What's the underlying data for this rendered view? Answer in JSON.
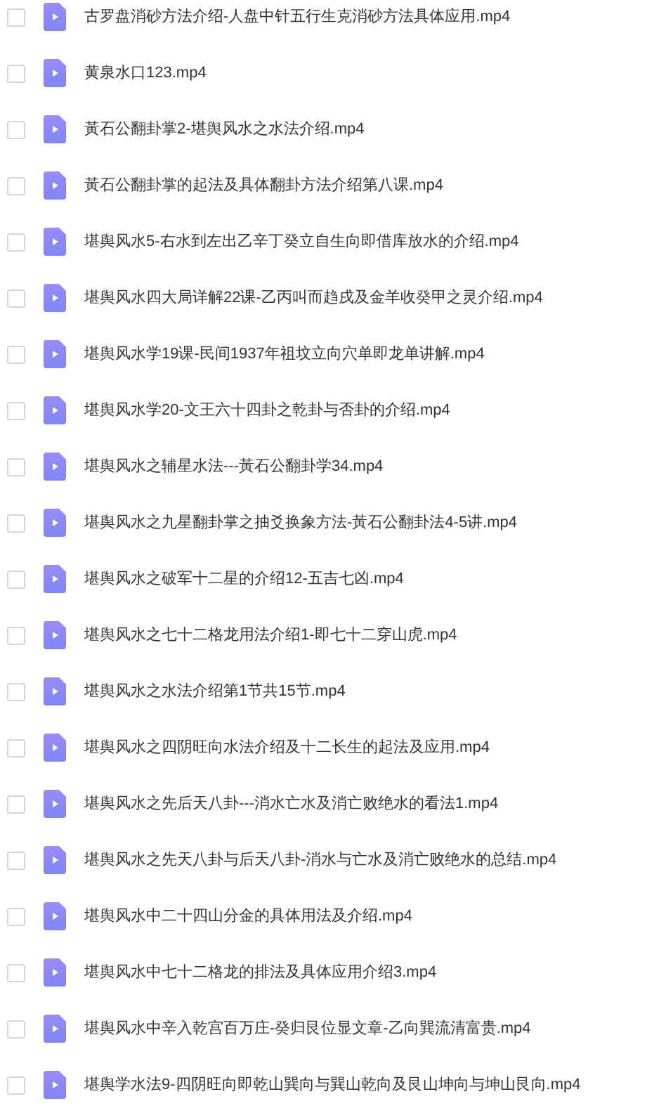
{
  "files": [
    {
      "name": "古罗盘消砂方法介绍-人盘中针五行生克消砂方法具体应用.mp4",
      "checked": false
    },
    {
      "name": "黄泉水口123.mp4",
      "checked": false
    },
    {
      "name": "黃石公翻卦掌2-堪舆风水之水法介绍.mp4",
      "checked": false
    },
    {
      "name": "黃石公翻卦掌的起法及具体翻卦方法介绍第八课.mp4",
      "checked": false
    },
    {
      "name": "堪舆风水5-右水到左出乙辛丁癸立自生向即借库放水的介绍.mp4",
      "checked": false
    },
    {
      "name": "堪舆风水四大局详解22课-乙丙叫而趋戌及金羊收癸甲之灵介绍.mp4",
      "checked": false
    },
    {
      "name": "堪舆风水学19课-民间1937年祖坟立向穴单即龙单讲解.mp4",
      "checked": false
    },
    {
      "name": "堪舆风水学20-文王六十四卦之乾卦与否卦的介绍.mp4",
      "checked": false
    },
    {
      "name": "堪舆风水之辅星水法---黃石公翻卦学34.mp4",
      "checked": false
    },
    {
      "name": "堪舆风水之九星翻卦掌之抽爻换象方法-黃石公翻卦法4-5讲.mp4",
      "checked": false
    },
    {
      "name": "堪舆风水之破军十二星的介绍12-五吉七凶.mp4",
      "checked": false
    },
    {
      "name": "堪舆风水之七十二格龙用法介绍1-即七十二穿山虎.mp4",
      "checked": false
    },
    {
      "name": "堪舆风水之水法介绍第1节共15节.mp4",
      "checked": false
    },
    {
      "name": "堪舆风水之四阴旺向水法介绍及十二长生的起法及应用.mp4",
      "checked": false
    },
    {
      "name": "堪舆风水之先后天八卦---消水亡水及消亡败绝水的看法1.mp4",
      "checked": false
    },
    {
      "name": "堪舆风水之先天八卦与后天八卦-消水与亡水及消亡败绝水的总结.mp4",
      "checked": false
    },
    {
      "name": "堪舆风水中二十四山分金的具体用法及介绍.mp4",
      "checked": false
    },
    {
      "name": "堪舆风水中七十二格龙的排法及具体应用介绍3.mp4",
      "checked": false
    },
    {
      "name": "堪舆风水中辛入乾宫百万庄-癸归艮位显文章-乙向巽流清富贵.mp4",
      "checked": false
    },
    {
      "name": "堪舆学水法9-四阴旺向即乾山巽向与巽山乾向及艮山坤向与坤山艮向.mp4",
      "checked": false
    }
  ]
}
